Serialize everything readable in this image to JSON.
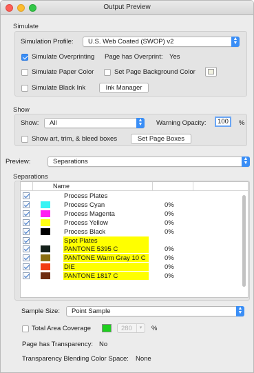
{
  "window": {
    "title": "Output Preview"
  },
  "simulate": {
    "section_label": "Simulate",
    "profile_label": "Simulation Profile:",
    "profile_value": "U.S. Web Coated (SWOP) v2",
    "overprinting_label": "Simulate Overprinting",
    "overprinting_checked": true,
    "page_has_overprint_label": "Page has Overprint:",
    "page_has_overprint_value": "Yes",
    "paper_color_label": "Simulate Paper Color",
    "page_bg_label": "Set Page Background Color",
    "black_ink_label": "Simulate Black Ink",
    "ink_manager_label": "Ink Manager"
  },
  "show": {
    "section_label": "Show",
    "show_label": "Show:",
    "show_value": "All",
    "warning_opacity_label": "Warning Opacity:",
    "warning_opacity_value": "100",
    "percent": "%",
    "boxes_label": "Show art, trim, & bleed boxes",
    "set_page_boxes_label": "Set Page Boxes"
  },
  "preview": {
    "label": "Preview:",
    "value": "Separations"
  },
  "separations": {
    "section_label": "Separations",
    "column_name": "Name",
    "rows": [
      {
        "name": "Process Plates",
        "percent": "",
        "color": "",
        "highlight": false,
        "header": true
      },
      {
        "name": "Process Cyan",
        "percent": "0%",
        "color": "#36f4f4",
        "highlight": false
      },
      {
        "name": "Process Magenta",
        "percent": "0%",
        "color": "#ff1ff2",
        "highlight": false
      },
      {
        "name": "Process Yellow",
        "percent": "0%",
        "color": "#ffff14",
        "highlight": false
      },
      {
        "name": "Process Black",
        "percent": "0%",
        "color": "#000000",
        "highlight": false
      },
      {
        "name": "Spot Plates",
        "percent": "",
        "color": "",
        "highlight": true,
        "header": true
      },
      {
        "name": "PANTONE 5395 C",
        "percent": "0%",
        "color": "#14201a",
        "highlight": true
      },
      {
        "name": "PANTONE Warm Gray 10 C",
        "percent": "0%",
        "color": "#8a6e10",
        "highlight": true
      },
      {
        "name": "DIE",
        "percent": "0%",
        "color": "#f23c12",
        "highlight": true
      },
      {
        "name": "PANTONE 1817 C",
        "percent": "0%",
        "color": "#6e2a10",
        "highlight": true
      }
    ]
  },
  "sample": {
    "label": "Sample Size:",
    "value": "Point Sample"
  },
  "coverage": {
    "label": "Total Area Coverage",
    "value": "280",
    "percent": "%",
    "swatch_color": "#1ed01e"
  },
  "transparency": {
    "label": "Page has Transparency:",
    "value": "No",
    "blending_label": "Transparency Blending Color Space:",
    "blending_value": "None"
  },
  "colors": {
    "accent": "#3a8ef6",
    "highlight": "#ffff00"
  }
}
